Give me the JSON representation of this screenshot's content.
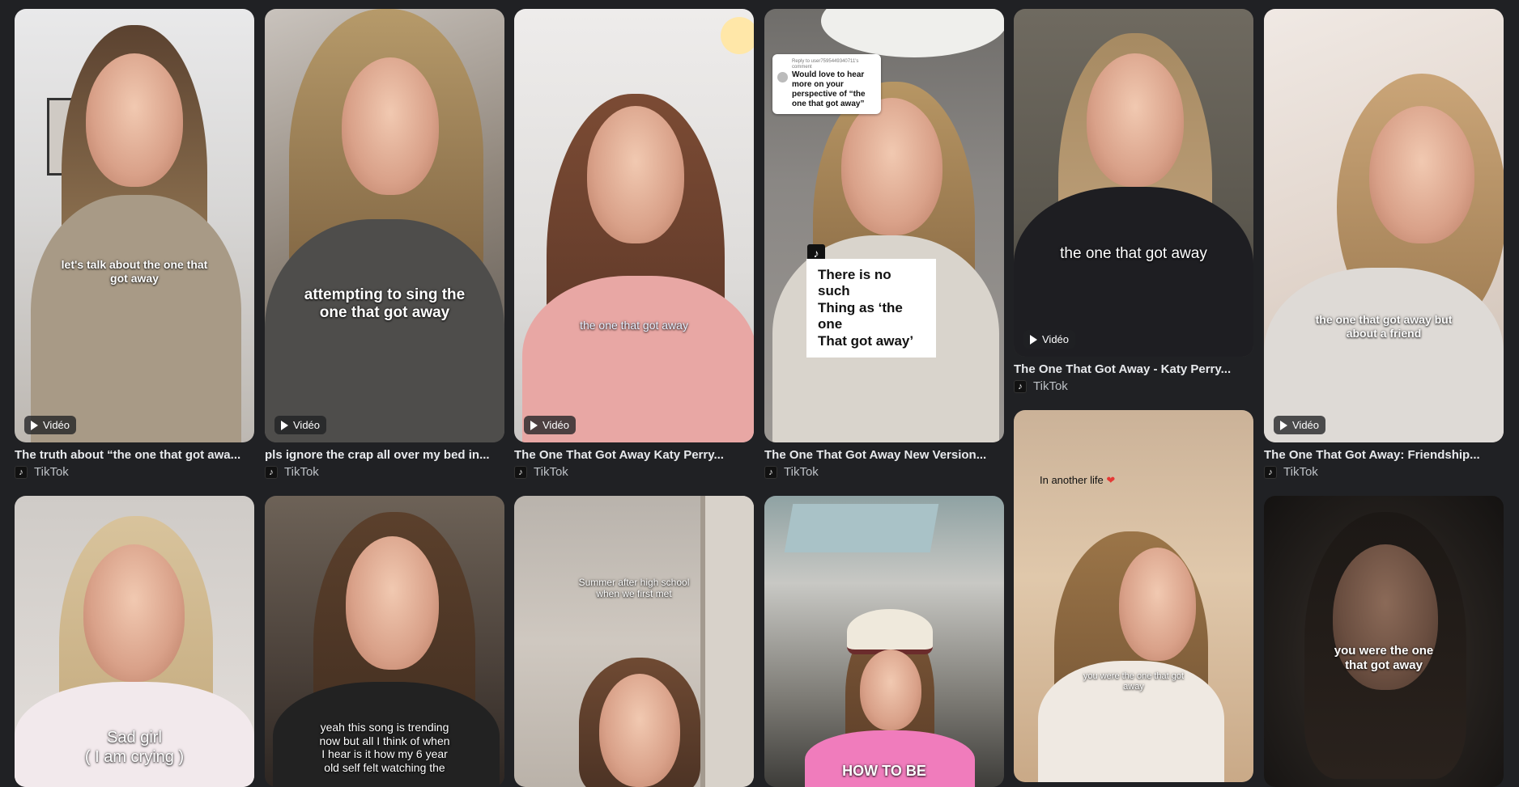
{
  "results": [
    {
      "title": "The truth about “the one that got awa...",
      "source": "TikTok",
      "badge": "Vidéo",
      "caption": "let's talk about the one that\ngot away"
    },
    {
      "title": "pls ignore the crap all over my bed in...",
      "source": "TikTok",
      "badge": "Vidéo",
      "caption": "attempting to sing the\none that got away"
    },
    {
      "title": "The One That Got Away Katy Perry...",
      "source": "TikTok",
      "badge": "Vidéo",
      "caption": "the one that got away"
    },
    {
      "title": "The One That Got Away New Version...",
      "source": "TikTok",
      "reply_header": "Reply to user7595449340711's comment",
      "reply_text": "Would love to hear more on your perspective of “the one that got away”",
      "caption": "There is no such\nThing as ‘the one\nThat got away’"
    },
    {
      "title": "The One That Got Away - Katy Perry...",
      "source": "TikTok",
      "badge": "Vidéo",
      "caption": "the one that got away"
    },
    {
      "title": "The One That Got Away: Friendship...",
      "source": "TikTok",
      "badge": "Vidéo",
      "caption": "the one that got away but\nabout a friend"
    },
    {
      "caption": "Sad girl\n( I am crying )"
    },
    {
      "caption": "yeah this song is trending\nnow but all I think of when\nI hear is it how my 6 year\nold self felt watching the"
    },
    {
      "caption": "Summer after high school\nwhen we first met"
    },
    {
      "caption": "HOW TO BE"
    },
    {
      "caption": "In another life",
      "caption2": "you were the one that got\naway"
    },
    {
      "caption": "you were the one\nthat got away"
    }
  ],
  "icons": {
    "heart": "❤",
    "tiktok": "♪",
    "play": "play-icon"
  },
  "colors": {
    "background": "#202124",
    "title": "#e8eaed",
    "source": "#bdc1c6"
  }
}
